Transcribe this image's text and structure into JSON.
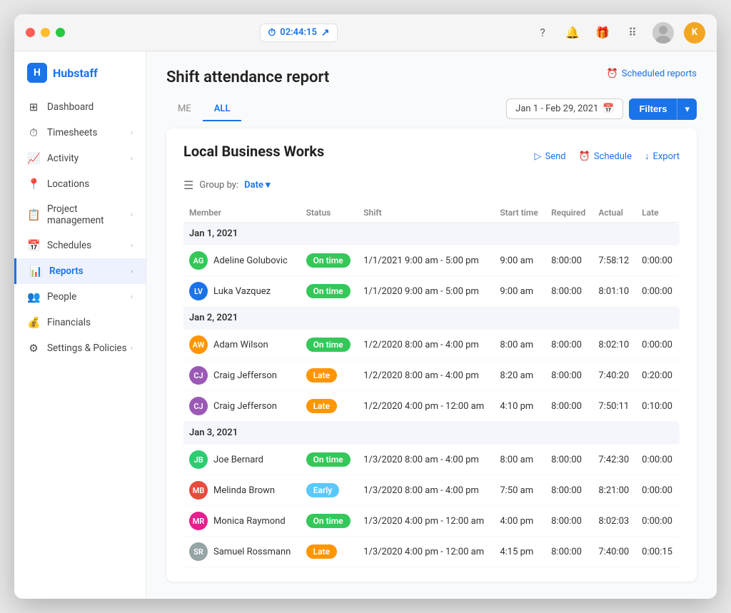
{
  "window": {
    "timer": "02:44:15"
  },
  "titlebar": {
    "icons": [
      "?",
      "🔔",
      "🎁",
      "⠿"
    ],
    "user_initial": "K"
  },
  "sidebar": {
    "logo": "Hubstaff",
    "items": [
      {
        "id": "dashboard",
        "label": "Dashboard",
        "icon": "⊞",
        "hasChevron": false
      },
      {
        "id": "timesheets",
        "label": "Timesheets",
        "icon": "⏱",
        "hasChevron": true
      },
      {
        "id": "activity",
        "label": "Activity",
        "icon": "📈",
        "hasChevron": true
      },
      {
        "id": "locations",
        "label": "Locations",
        "icon": "📍",
        "hasChevron": false
      },
      {
        "id": "project-management",
        "label": "Project management",
        "icon": "📋",
        "hasChevron": true
      },
      {
        "id": "schedules",
        "label": "Schedules",
        "icon": "📅",
        "hasChevron": true
      },
      {
        "id": "reports",
        "label": "Reports",
        "icon": "📊",
        "hasChevron": true,
        "active": true
      },
      {
        "id": "people",
        "label": "People",
        "icon": "👥",
        "hasChevron": true
      },
      {
        "id": "financials",
        "label": "Financials",
        "icon": "💰",
        "hasChevron": false
      },
      {
        "id": "settings",
        "label": "Settings & Policies",
        "icon": "⚙",
        "hasChevron": true
      }
    ]
  },
  "page": {
    "title": "Shift attendance report",
    "scheduled_reports_label": "Scheduled reports",
    "tabs": [
      {
        "id": "me",
        "label": "ME",
        "active": false
      },
      {
        "id": "all",
        "label": "ALL",
        "active": true
      }
    ],
    "date_range": "Jan 1 - Feb 29, 2021",
    "filters_btn": "Filters",
    "org_name": "Local Business Works",
    "actions": [
      {
        "id": "send",
        "label": "Send",
        "icon": "▷"
      },
      {
        "id": "schedule",
        "label": "Schedule",
        "icon": "⏰"
      },
      {
        "id": "export",
        "label": "Export",
        "icon": "↓"
      }
    ],
    "group_by": "Date",
    "table": {
      "headers": [
        "Member",
        "Status",
        "Shift",
        "Start time",
        "Required",
        "Actual",
        "Late"
      ],
      "groups": [
        {
          "date": "Jan 1, 2021",
          "rows": [
            {
              "member": "Adeline Golubovic",
              "av_color": "av-green",
              "av_initials": "AG",
              "status": "On time",
              "status_class": "status-ontime",
              "shift": "1/1/2021 9:00 am - 5:00 pm",
              "start_time": "9:00 am",
              "required": "8:00:00",
              "actual": "7:58:12",
              "late": "0:00:00"
            },
            {
              "member": "Luka Vazquez",
              "av_color": "av-blue",
              "av_initials": "LV",
              "status": "On time",
              "status_class": "status-ontime",
              "shift": "1/1/2020 9:00 am - 5:00 pm",
              "start_time": "9:00 am",
              "required": "8:00:00",
              "actual": "8:01:10",
              "late": "0:00:00"
            }
          ]
        },
        {
          "date": "Jan 2, 2021",
          "rows": [
            {
              "member": "Adam Wilson",
              "av_color": "av-orange",
              "av_initials": "AW",
              "status": "On time",
              "status_class": "status-ontime",
              "shift": "1/2/2020 8:00 am - 4:00 pm",
              "start_time": "8:00 am",
              "required": "8:00:00",
              "actual": "8:02:10",
              "late": "0:00:00"
            },
            {
              "member": "Craig Jefferson",
              "av_color": "av-purple",
              "av_initials": "CJ",
              "status": "Late",
              "status_class": "status-late",
              "shift": "1/2/2020 8:00 am - 4:00 pm",
              "start_time": "8:20 am",
              "required": "8:00:00",
              "actual": "7:40:20",
              "late": "0:20:00"
            },
            {
              "member": "Craig Jefferson",
              "av_color": "av-purple",
              "av_initials": "CJ",
              "status": "Late",
              "status_class": "status-late",
              "shift": "1/2/2020 4:00 pm - 12:00 am",
              "start_time": "4:10 pm",
              "required": "8:00:00",
              "actual": "7:50:11",
              "late": "0:10:00"
            }
          ]
        },
        {
          "date": "Jan 3, 2021",
          "rows": [
            {
              "member": "Joe Bernard",
              "av_color": "av-teal",
              "av_initials": "JB",
              "status": "On time",
              "status_class": "status-ontime",
              "shift": "1/3/2020 8:00 am - 4:00 pm",
              "start_time": "8:00 am",
              "required": "8:00:00",
              "actual": "7:42:30",
              "late": "0:00:00"
            },
            {
              "member": "Melinda Brown",
              "av_color": "av-red",
              "av_initials": "MB",
              "status": "Early",
              "status_class": "status-early",
              "shift": "1/3/2020 8:00 am - 4:00 pm",
              "start_time": "7:50 am",
              "required": "8:00:00",
              "actual": "8:21:00",
              "late": "0:00:00"
            },
            {
              "member": "Monica Raymond",
              "av_color": "av-pink",
              "av_initials": "MR",
              "status": "On time",
              "status_class": "status-ontime",
              "shift": "1/3/2020 4:00 pm - 12:00 am",
              "start_time": "4:00 pm",
              "required": "8:00:00",
              "actual": "8:02:03",
              "late": "0:00:00"
            },
            {
              "member": "Samuel Rossmann",
              "av_color": "av-gray",
              "av_initials": "SR",
              "status": "Late",
              "status_class": "status-late",
              "shift": "1/3/2020 4:00 pm - 12:00 am",
              "start_time": "4:15 pm",
              "required": "8:00:00",
              "actual": "7:40:00",
              "late": "0:00:15"
            }
          ]
        }
      ]
    }
  }
}
